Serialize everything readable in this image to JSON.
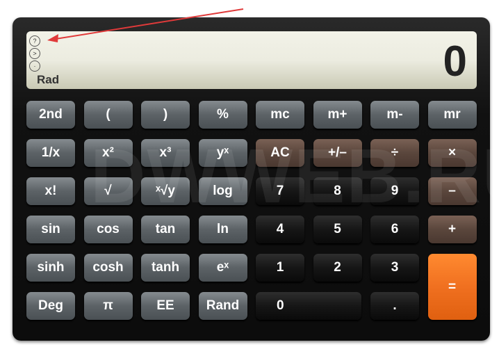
{
  "display": {
    "value": "0",
    "mode": "Rad",
    "indicators": [
      "?",
      ">",
      "·"
    ]
  },
  "watermark": "DWWEB.RU",
  "annotation": {
    "arrow_color": "#e03a3a"
  },
  "colors": {
    "function": "#5c6266",
    "operator": "#5a463c",
    "digit": "#161616",
    "equals": "#f07020"
  },
  "rows": [
    [
      {
        "l": "2nd",
        "t": "fn"
      },
      {
        "l": "(",
        "t": "fn"
      },
      {
        "l": ")",
        "t": "fn"
      },
      {
        "l": "%",
        "t": "fn"
      },
      {
        "l": "mc",
        "t": "fn"
      },
      {
        "l": "m+",
        "t": "fn"
      },
      {
        "l": "m-",
        "t": "fn"
      },
      {
        "l": "mr",
        "t": "fn"
      }
    ],
    [
      {
        "l": "1/x",
        "t": "fn"
      },
      {
        "l": "x²",
        "t": "fn"
      },
      {
        "l": "x³",
        "t": "fn"
      },
      {
        "l": "yˣ",
        "t": "fn"
      },
      {
        "l": "AC",
        "t": "op"
      },
      {
        "l": "+/–",
        "t": "op"
      },
      {
        "l": "÷",
        "t": "op"
      },
      {
        "l": "×",
        "t": "op"
      }
    ],
    [
      {
        "l": "x!",
        "t": "fn"
      },
      {
        "l": "√",
        "t": "fn"
      },
      {
        "l": "ˣ√y",
        "t": "fn"
      },
      {
        "l": "log",
        "t": "fn"
      },
      {
        "l": "7",
        "t": "dg"
      },
      {
        "l": "8",
        "t": "dg"
      },
      {
        "l": "9",
        "t": "dg"
      },
      {
        "l": "–",
        "t": "op"
      }
    ],
    [
      {
        "l": "sin",
        "t": "fn"
      },
      {
        "l": "cos",
        "t": "fn"
      },
      {
        "l": "tan",
        "t": "fn"
      },
      {
        "l": "ln",
        "t": "fn"
      },
      {
        "l": "4",
        "t": "dg"
      },
      {
        "l": "5",
        "t": "dg"
      },
      {
        "l": "6",
        "t": "dg"
      },
      {
        "l": "+",
        "t": "op"
      }
    ],
    [
      {
        "l": "sinh",
        "t": "fn"
      },
      {
        "l": "cosh",
        "t": "fn"
      },
      {
        "l": "tanh",
        "t": "fn"
      },
      {
        "l": "eˣ",
        "t": "fn"
      },
      {
        "l": "1",
        "t": "dg"
      },
      {
        "l": "2",
        "t": "dg"
      },
      {
        "l": "3",
        "t": "dg"
      },
      {
        "l": "=",
        "t": "eq"
      }
    ],
    [
      {
        "l": "Deg",
        "t": "fn"
      },
      {
        "l": "π",
        "t": "fn"
      },
      {
        "l": "EE",
        "t": "fn"
      },
      {
        "l": "Rand",
        "t": "fn"
      },
      {
        "l": "0",
        "t": "dg"
      },
      {
        "l": ".",
        "t": "dg"
      }
    ]
  ]
}
